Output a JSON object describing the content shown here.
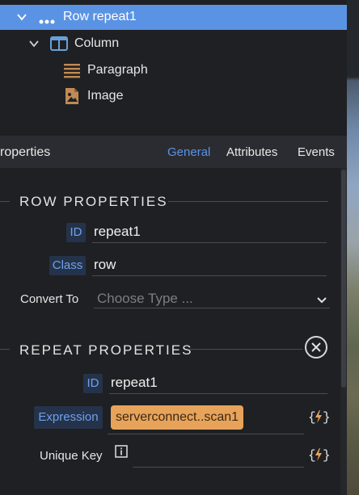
{
  "tree": {
    "items": [
      {
        "label": "Row repeat1",
        "icon": "repeat-icon",
        "selected": true
      },
      {
        "label": "Column",
        "icon": "column-icon"
      },
      {
        "label": "Paragraph",
        "icon": "paragraph-icon"
      },
      {
        "label": "Image",
        "icon": "image-icon"
      }
    ]
  },
  "properties": {
    "title": "roperties",
    "tabs": [
      "General",
      "Attributes",
      "Events"
    ],
    "active_tab": "General"
  },
  "row_properties": {
    "heading": "ROW PROPERTIES",
    "id_label": "ID",
    "id_value": "repeat1",
    "class_label": "Class",
    "class_value": "row",
    "convert_label": "Convert To",
    "convert_placeholder": "Choose Type ..."
  },
  "repeat_properties": {
    "heading": "REPEAT PROPERTIES",
    "id_label": "ID",
    "id_value": "repeat1",
    "expression_label": "Expression",
    "expression_value": "serverconnect..scan1",
    "unique_key_label": "Unique Key",
    "unique_key_value": ""
  },
  "colors": {
    "accent": "#5b93e4",
    "chip": "#e8a35a",
    "panel": "#1f2023"
  }
}
